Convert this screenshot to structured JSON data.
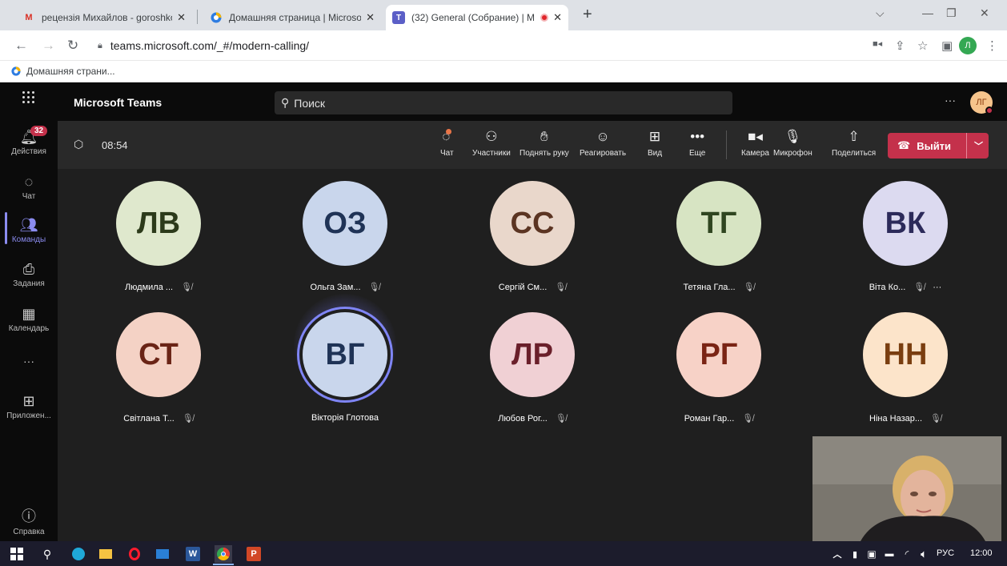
{
  "browser": {
    "tabs": [
      {
        "icon": "gmail-icon",
        "title": "рецензія Михайлов - goroshkov"
      },
      {
        "icon": "microsoft-icon",
        "title": "Домашняя страница | Microsoft"
      },
      {
        "icon": "teams-icon",
        "title": "(32) General (Собрание) | M"
      }
    ],
    "new_tab": "+",
    "url": "teams.microsoft.com/_#/modern-calling/",
    "profile_initial": "Л",
    "bookmark": "Домашняя страни..."
  },
  "teams": {
    "app_title": "Microsoft Teams",
    "search_placeholder": "Поиск",
    "more": "···",
    "user_initials": "ЛГ"
  },
  "rail": {
    "activity_badge": "32",
    "items": [
      {
        "icon": "bell-icon",
        "label": "Действия"
      },
      {
        "icon": "chat-icon",
        "label": "Чат"
      },
      {
        "icon": "teams-icon",
        "label": "Команды"
      },
      {
        "icon": "assignments-icon",
        "label": "Задания"
      },
      {
        "icon": "calendar-icon",
        "label": "Календарь"
      },
      {
        "icon": "more-icon",
        "label": "···"
      },
      {
        "icon": "apps-icon",
        "label": "Приложен..."
      },
      {
        "icon": "help-icon",
        "label": "Справка"
      }
    ]
  },
  "meeting": {
    "timer": "08:54",
    "controls": [
      "Чат",
      "Участники",
      "Поднять руку",
      "Реагировать",
      "Вид",
      "Еще",
      "Камера",
      "Микрофон",
      "Поделиться"
    ],
    "leave_label": "Выйти"
  },
  "participants": [
    {
      "initials": "ЛВ",
      "name": "Людмила ...",
      "muted": true,
      "bg": "#dfe8cd",
      "fg": "#2c3a1a"
    },
    {
      "initials": "ОЗ",
      "name": "Ольга Зам...",
      "muted": true,
      "bg": "#c9d6ec",
      "fg": "#1f3356"
    },
    {
      "initials": "СС",
      "name": "Сергій См...",
      "muted": true,
      "bg": "#e9d7cb",
      "fg": "#5b3422"
    },
    {
      "initials": "ТГ",
      "name": "Тетяна Гла...",
      "muted": true,
      "bg": "#d7e4c3",
      "fg": "#2f4520"
    },
    {
      "initials": "ВК",
      "name": "Віта Ко...",
      "muted": true,
      "bg": "#dcdaf0",
      "fg": "#2c2a5a",
      "more": "···"
    },
    {
      "initials": "СТ",
      "name": "Світлана Т...",
      "muted": true,
      "bg": "#f4d2c5",
      "fg": "#6a2416"
    },
    {
      "initials": "ВГ",
      "name": "Вікторія Глотова",
      "muted": false,
      "bg": "#c9d6ec",
      "fg": "#1f3356",
      "speaking": true
    },
    {
      "initials": "ЛР",
      "name": "Любов Рог...",
      "muted": true,
      "bg": "#f0d0d4",
      "fg": "#6a1f2a"
    },
    {
      "initials": "РГ",
      "name": "Роман Гар...",
      "muted": true,
      "bg": "#f7d2c7",
      "fg": "#7a2414"
    },
    {
      "initials": "НН",
      "name": "Ніна Назар...",
      "muted": true,
      "bg": "#fce4ca",
      "fg": "#7a3e10"
    }
  ],
  "taskbar": {
    "lang": "РУС",
    "time": "12:00"
  }
}
